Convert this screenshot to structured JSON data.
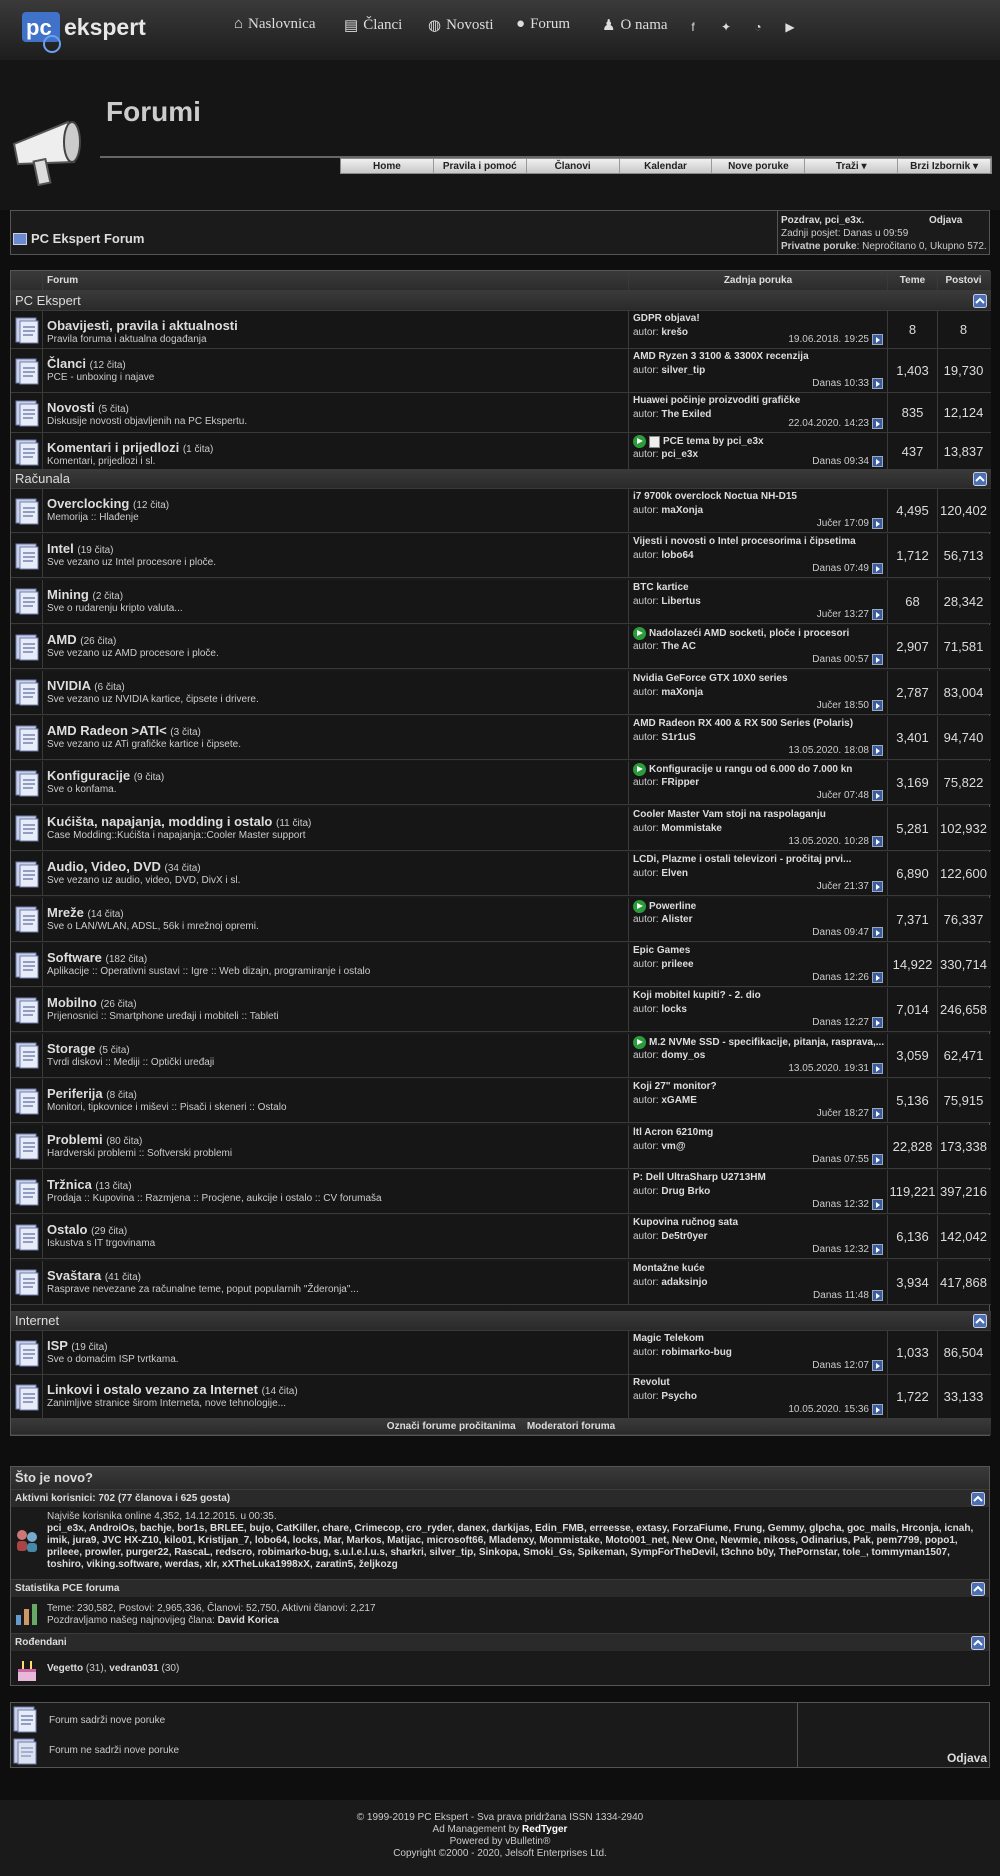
{
  "nav": {
    "home": "Naslovnica",
    "articles": "Članci",
    "news": "Novosti",
    "forum": "Forum",
    "about": "O nama"
  },
  "brand": {
    "accent": "#4a7bd0"
  },
  "page_title": "Forumi",
  "navtabs": [
    "Home",
    "Pravila i pomoć",
    "Članovi",
    "Kalendar",
    "Nove poruke",
    "Traži",
    "Brzi Izbornik"
  ],
  "breadcrumb": {
    "title": "PC Ekspert Forum"
  },
  "user": {
    "greeting": "Pozdrav, pci_e3x.",
    "logout": "Odjava",
    "last_visit": "Zadnji posjet: Danas u 09:59",
    "pm_label": "Privatne poruke",
    "pm_text": ": Nepročitano 0, Ukupno 572."
  },
  "headers": {
    "forum": "Forum",
    "last": "Zadnja poruka",
    "threads": "Teme",
    "posts": "Postovi"
  },
  "cat1": "PC Ekspert",
  "cat2": "Računala",
  "cat3": "Internet",
  "f": [
    {
      "t": "Obavijesti, pravila i aktualnosti",
      "c": "",
      "d": "Pravila foruma i aktualna događanja",
      "lt": "GDPR objava!",
      "la": "krešo",
      "ld": "19.06.2018. 19:25",
      "th": "8",
      "p": "8"
    },
    {
      "t": "Članci",
      "c": "(12 čita)",
      "d": "PCE - unboxing i najave",
      "lt": "AMD Ryzen 3 3100 & 3300X recenzija",
      "la": "silver_tip",
      "ld": "Danas 10:33",
      "th": "1,403",
      "p": "19,730"
    },
    {
      "t": "Novosti",
      "c": "(5 čita)",
      "d": "Diskusije novosti objavljenih na PC Ekspertu.",
      "lt": "Huawei počinje proizvoditi grafičke",
      "la": "The Exiled",
      "ld": "22.04.2020. 14:23",
      "th": "835",
      "p": "12,124"
    },
    {
      "t": "Komentari i prijedlozi",
      "c": "(1 čita)",
      "d": "Komentari, prijedlozi i sl.",
      "lt": "PCE tema by pci_e3x",
      "la": "pci_e3x",
      "ld": "Danas 09:34",
      "th": "437",
      "p": "13,837"
    },
    {
      "t": "Overclocking",
      "c": "(12 čita)",
      "d": "Memorija :: Hlađenje",
      "lt": "i7 9700k overclock Noctua NH-D15",
      "la": "maXonja",
      "ld": "Jučer 17:09",
      "th": "4,495",
      "p": "120,402"
    },
    {
      "t": "Intel",
      "c": "(19 čita)",
      "d": "Sve vezano uz Intel procesore i ploče.",
      "lt": "Vijesti i novosti o Intel procesorima i čipsetima",
      "la": "lobo64",
      "ld": "Danas 07:49",
      "th": "1,712",
      "p": "56,713"
    },
    {
      "t": "Mining",
      "c": "(2 čita)",
      "d": "Sve o rudarenju kripto valuta...",
      "lt": "BTC kartice",
      "la": "Libertus",
      "ld": "Jučer 13:27",
      "th": "68",
      "p": "28,342"
    },
    {
      "t": "AMD",
      "c": "(26 čita)",
      "d": "Sve vezano uz AMD procesore i ploče.",
      "lt": "Nadolazeći AMD socketi, ploče i procesori",
      "la": "The AC",
      "ld": "Danas 00:57",
      "th": "2,907",
      "p": "71,581"
    },
    {
      "t": "NVIDIA",
      "c": "(6 čita)",
      "d": "Sve vezano uz NVIDIA kartice, čipsete i drivere.",
      "lt": "Nvidia GeForce GTX 10X0 series",
      "la": "maXonja",
      "ld": "Jučer 18:50",
      "th": "2,787",
      "p": "83,004"
    },
    {
      "t": "AMD Radeon >ATI<",
      "c": "(3 čita)",
      "d": "Sve vezano uz ATi grafičke kartice i čipsete.",
      "lt": "AMD Radeon RX 400 & RX 500 Series (Polaris)",
      "la": "S1r1uS",
      "ld": "13.05.2020. 18:08",
      "th": "3,401",
      "p": "94,740"
    },
    {
      "t": "Konfiguracije",
      "c": "(9 čita)",
      "d": "Sve o konfama.",
      "lt": "Konfiguracije u rangu od 6.000 do 7.000 kn",
      "la": "FRipper",
      "ld": "Jučer 07:48",
      "th": "3,169",
      "p": "75,822"
    },
    {
      "t": "Kućišta, napajanja, modding i ostalo",
      "c": "(11 čita)",
      "d": "Case Modding::Kućišta i napajanja::Cooler Master support",
      "lt": "Cooler Master Vam stoji na raspolaganju",
      "la": "Mommistake",
      "ld": "13.05.2020. 10:28",
      "th": "5,281",
      "p": "102,932"
    },
    {
      "t": "Audio, Video, DVD",
      "c": "(34 čita)",
      "d": "Sve vezano uz audio, video, DVD, DivX i sl.",
      "lt": "LCDi, Plazme i ostali televizori - pročitaj prvi...",
      "la": "Elven",
      "ld": "Jučer 21:37",
      "th": "6,890",
      "p": "122,600"
    },
    {
      "t": "Mreže",
      "c": "(14 čita)",
      "d": "Sve o LAN/WLAN, ADSL, 56k i mrežnoj opremi.",
      "lt": "Powerline",
      "la": "Alister",
      "ld": "Danas 09:47",
      "th": "7,371",
      "p": "76,337"
    },
    {
      "t": "Software",
      "c": "(182 čita)",
      "d": "Aplikacije :: Operativni sustavi :: Igre :: Web dizajn, programiranje i ostalo",
      "lt": "Epic Games",
      "la": "prileee",
      "ld": "Danas 12:26",
      "th": "14,922",
      "p": "330,714"
    },
    {
      "t": "Mobilno",
      "c": "(26 čita)",
      "d": "Prijenosnici :: Smartphone uređaji i mobiteli :: Tableti",
      "lt": "Koji mobitel kupiti? - 2. dio",
      "la": "locks",
      "ld": "Danas 12:27",
      "th": "7,014",
      "p": "246,658"
    },
    {
      "t": "Storage",
      "c": "(5 čita)",
      "d": "Tvrdi diskovi :: Mediji :: Optički uređaji",
      "lt": "M.2 NVMe SSD - specifikacije, pitanja, rasprava,...",
      "la": "domy_os",
      "ld": "13.05.2020. 19:31",
      "th": "3,059",
      "p": "62,471"
    },
    {
      "t": "Periferija",
      "c": "(8 čita)",
      "d": "Monitori, tipkovnice i miševi :: Pisači i skeneri :: Ostalo",
      "lt": "Koji 27\" monitor?",
      "la": "xGAME",
      "ld": "Jučer 18:27",
      "th": "5,136",
      "p": "75,915"
    },
    {
      "t": "Problemi",
      "c": "(80 čita)",
      "d": "Hardverski problemi :: Softverski problemi",
      "lt": "ltl Acron 6210mg",
      "la": "vm@",
      "ld": "Danas 07:55",
      "th": "22,828",
      "p": "173,338"
    },
    {
      "t": "Tržnica",
      "c": "(13 čita)",
      "d": "Prodaja :: Kupovina :: Razmjena :: Procjene, aukcije i ostalo :: CV forumaša",
      "lt": "P: Dell UltraSharp U2713HM",
      "la": "Drug Brko",
      "ld": "Danas 12:32",
      "th": "119,221",
      "p": "397,216"
    },
    {
      "t": "Ostalo",
      "c": "(29 čita)",
      "d": "Iskustva s IT trgovinama",
      "lt": "Kupovina ručnog sata",
      "la": "De5tr0yer",
      "ld": "Danas 12:32",
      "th": "6,136",
      "p": "142,042"
    },
    {
      "t": "Svaštara",
      "c": "(41 čita)",
      "d": "Rasprave nevezane za računalne teme, poput popularnih \"Žderonja\"...",
      "lt": "Montažne kuće",
      "la": "adaksinjo",
      "ld": "Danas 11:48",
      "th": "3,934",
      "p": "417,868"
    },
    {
      "t": "ISP",
      "c": "(19 čita)",
      "d": "Sve o domaćim ISP tvrtkama.",
      "lt": "Magic Telekom",
      "la": "robimarko-bug",
      "ld": "Danas 12:07",
      "th": "1,033",
      "p": "86,504"
    },
    {
      "t": "Linkovi i ostalo vezano za Internet",
      "c": "(14 čita)",
      "d": "Zanimljive stranice širom Interneta, nove tehnologije...",
      "lt": "Revolut",
      "la": "Psycho",
      "ld": "10.05.2020. 15:36",
      "th": "1,722",
      "p": "33,133"
    }
  ],
  "bottom_links": [
    "Označi forume pročitanima",
    "Moderatori foruma"
  ],
  "whatsnew": {
    "title": "Što je novo?",
    "active_label": "Aktivni korisnici: 702 (77 članova i 625 gosta)",
    "record": "Najviše korisnika online 4,352, 14.12.2015. u 00:35.",
    "users": "pci_e3x, AndroiOs, bachje, bor1s, BRLEE, bujo, CatKiller, chare, Crimecop, cro_ryder, danex, darkijas, Edin_FMB, erreesse, extasy, ForzaFiume, Frung, Gemmy, glpcha, goc_mails, Hrconja, icnah, imik, jura9, JVC HX-Z10, kilo01, Kristijan_7, lobo64, locks, Mar, Markos, Matijac, microsoft66, Mladenxy, Mommistake, Moto001_net, New One, Newmie, nikoss, Odinarius, Pak, pem7799, popo1, prileee, prowler, purger22, RascaL, redscro, robimarko-bug, s.u.l.e.l.u.s, sharkri, silver_tip, Sinkopa, Smoki_Gs, Spikeman, SympForTheDevil, t3chno b0y, ThePornstar, tole_, tommyman1507, toshiro, viking.software, werdas, xlr, xXTheLuka1998xX, zaratin5, željkozg",
    "stats_label": "Statistika PCE foruma",
    "stats": "Teme: 230,582, Postovi: 2,965,336, Članovi: 52,750, Aktivni članovi: 2,217",
    "welcome": "Pozdravljamo našeg najnovijeg člana:",
    "newest": "David Korica",
    "bday_label": "Rođendani",
    "bday1": "Vegetto",
    "bday1n": "(31)",
    "bday2": "vedran031",
    "bday2n": "(30)"
  },
  "legend": {
    "new": "Forum sadrži nove poruke",
    "old": "Forum ne sadrži nove poruke",
    "logout": "Odjava"
  },
  "footer": {
    "l1": "© 1999-2019 PC Ekspert - Sva prava pridržana ISSN 1334-2940",
    "l2a": "Ad Management by ",
    "l2b": "RedTyger",
    "l3": "Powered by vBulletin®",
    "l4": "Copyright ©2000 - 2020, Jelsoft Enterprises Ltd."
  }
}
